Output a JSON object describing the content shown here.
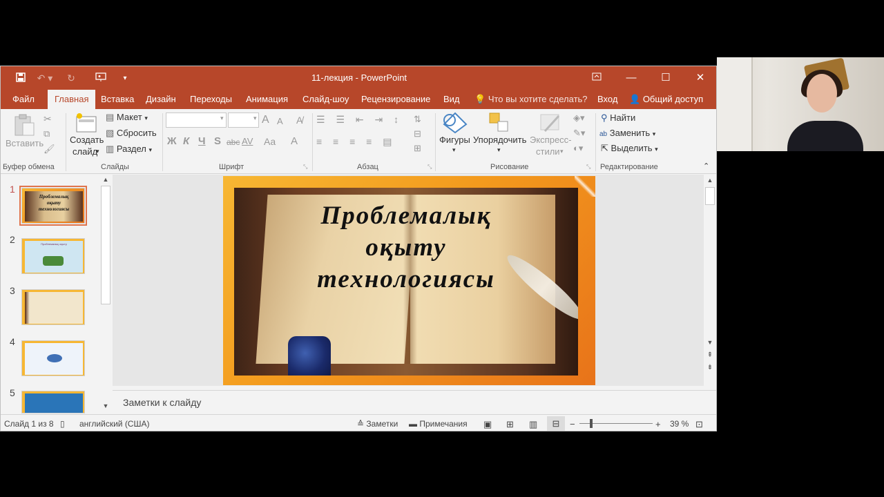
{
  "window": {
    "title": "11-лекция - PowerPoint"
  },
  "tabs": [
    {
      "label": "Файл"
    },
    {
      "label": "Главная"
    },
    {
      "label": "Вставка"
    },
    {
      "label": "Дизайн"
    },
    {
      "label": "Переходы"
    },
    {
      "label": "Анимация"
    },
    {
      "label": "Слайд-шоу"
    },
    {
      "label": "Рецензирование"
    },
    {
      "label": "Вид"
    },
    {
      "label": "Что вы хотите сделать?"
    },
    {
      "label": "Вход"
    },
    {
      "label": "Общий доступ"
    }
  ],
  "ribbon": {
    "clipboard": {
      "paste": "Вставить",
      "group": "Буфер обмена"
    },
    "slides": {
      "new_line1": "Создать",
      "new_line2": "слайд",
      "layout": "Макет",
      "reset": "Сбросить",
      "section": "Раздел",
      "group": "Слайды"
    },
    "font": {
      "group": "Шрифт",
      "bold": "Ж",
      "italic": "К",
      "underline": "Ч",
      "shadow": "S",
      "strike": "abc",
      "spacing": "AV",
      "case": "Aa",
      "color": "A",
      "grow": "A",
      "shrink": "A"
    },
    "paragraph": {
      "group": "Абзац"
    },
    "drawing": {
      "shapes": "Фигуры",
      "arrange": "Упорядочить",
      "styles_line1": "Экспресс-",
      "styles_line2": "стили",
      "group": "Рисование"
    },
    "editing": {
      "find": "Найти",
      "replace": "Заменить",
      "select": "Выделить",
      "group": "Редактирование"
    }
  },
  "thumbnails": [
    {
      "num": "1",
      "selected": true
    },
    {
      "num": "2",
      "selected": false,
      "caption": "Проблемалық оқыту"
    },
    {
      "num": "3",
      "selected": false
    },
    {
      "num": "4",
      "selected": false
    },
    {
      "num": "5",
      "selected": false
    }
  ],
  "slide": {
    "title_line1": "Проблемалық",
    "title_line2": "оқыту",
    "title_line3": "технологиясы"
  },
  "notes": {
    "placeholder": "Заметки к слайду"
  },
  "status": {
    "slide_of": "Слайд 1 из 8",
    "language": "английский (США)",
    "notes": "Заметки",
    "comments": "Примечания",
    "zoom": "39 %"
  },
  "colors": {
    "accent": "#b7472a",
    "slide_border": "#f39a1d"
  }
}
